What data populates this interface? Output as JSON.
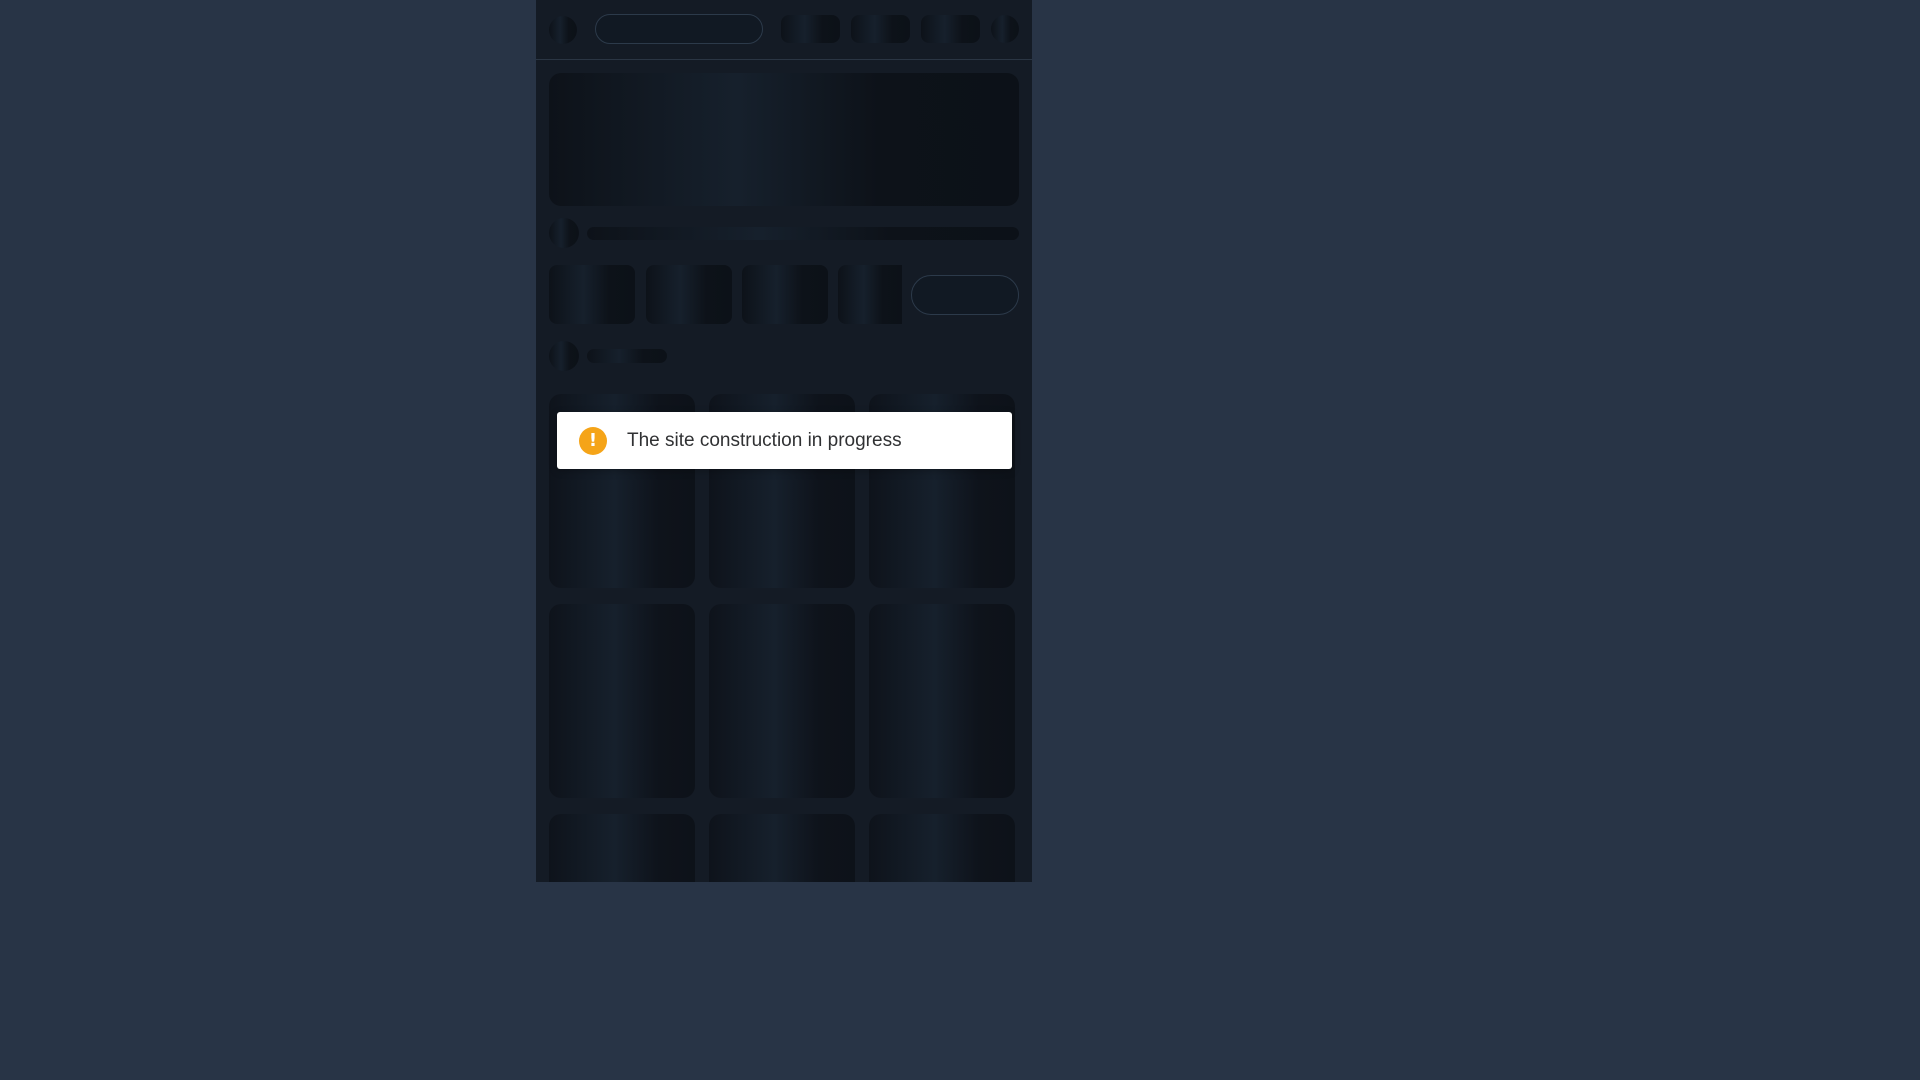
{
  "toast": {
    "icon": "warning-icon",
    "icon_glyph": "!",
    "message": "The site construction in progress",
    "icon_color": "#f5a418"
  },
  "colors": {
    "page_background": "#283446",
    "app_background": "#141b25",
    "toast_background": "#ffffff"
  }
}
